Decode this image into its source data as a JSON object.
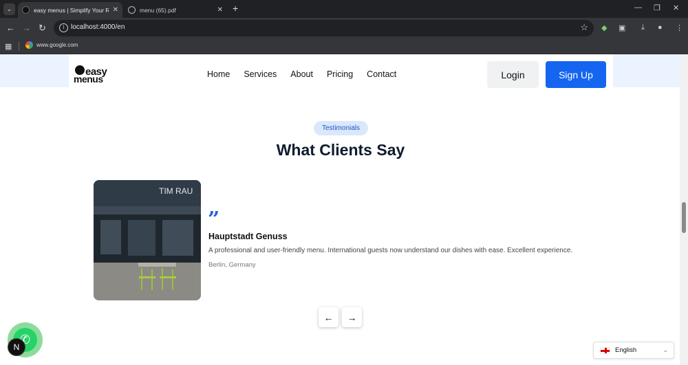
{
  "browser": {
    "tabs": [
      {
        "title": "easy menus | Simplify Your Res",
        "active": true
      },
      {
        "title": "menu (65).pdf",
        "active": false
      }
    ],
    "url": "localhost:4000/en",
    "bookmarks": [
      {
        "label": "www.google.com"
      }
    ]
  },
  "nav": {
    "logo_line1": "easy",
    "logo_line2": "menus",
    "links": [
      "Home",
      "Services",
      "About",
      "Pricing",
      "Contact"
    ],
    "login": "Login",
    "signup": "Sign Up"
  },
  "testimonials": {
    "badge": "Testimonials",
    "heading": "What Clients Say",
    "quote_mark": "”",
    "item": {
      "name": "Hauptstadt Genuss",
      "text": "A professional and user-friendly menu. International guests now understand our dishes with ease. Excellent experience.",
      "location": "Berlin, Germany",
      "photo_sign": "TIM RAU"
    },
    "prev_arrow": "←",
    "next_arrow": "→"
  },
  "widgets": {
    "whatsapp_icon": "whatsapp-icon",
    "n_badge": "N",
    "language": "English"
  },
  "colors": {
    "accent": "#1565f0",
    "badge_bg": "#dbe8fb",
    "heading": "#0f1b2e"
  }
}
